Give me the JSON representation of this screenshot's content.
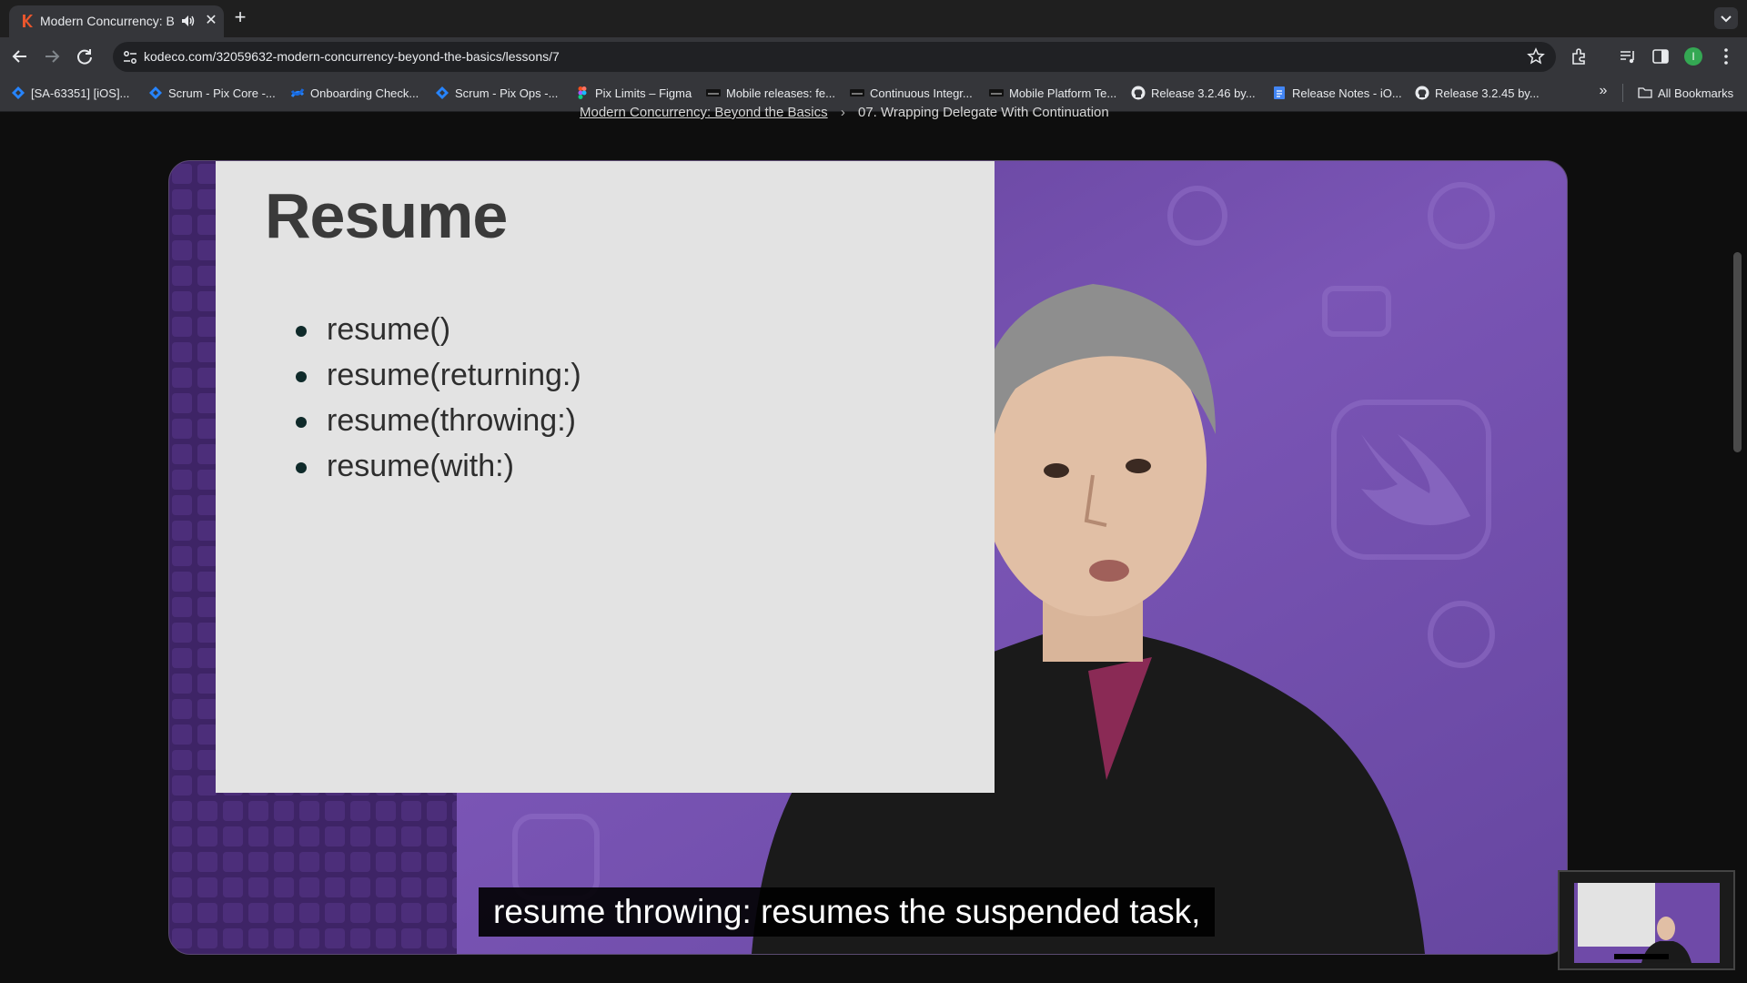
{
  "browser": {
    "tab": {
      "title": "Modern Concurrency: Beyond the Basics",
      "favicon_color": "#e9562d"
    },
    "url": "kodeco.com/32059632-modern-concurrency-beyond-the-basics/lessons/7",
    "profile_initial": "I",
    "bookmarks": [
      {
        "label": "[SA-63351] [iOS]...",
        "icon": "jira-icon"
      },
      {
        "label": "Scrum - Pix Core -...",
        "icon": "jira-icon"
      },
      {
        "label": "Onboarding Check...",
        "icon": "confluence-icon"
      },
      {
        "label": "Scrum - Pix Ops -...",
        "icon": "jira-icon"
      },
      {
        "label": "Pix Limits – Figma",
        "icon": "figma-icon"
      },
      {
        "label": "Mobile releases: fe...",
        "icon": "site-icon"
      },
      {
        "label": "Continuous Integr...",
        "icon": "site-icon"
      },
      {
        "label": "Mobile Platform Te...",
        "icon": "site-icon"
      },
      {
        "label": "Release 3.2.46 by...",
        "icon": "github-icon"
      },
      {
        "label": "Release Notes - iO...",
        "icon": "docs-icon"
      },
      {
        "label": "Release 3.2.45 by...",
        "icon": "github-icon"
      }
    ],
    "all_bookmarks": "All Bookmarks"
  },
  "breadcrumb": {
    "course": "Modern Concurrency: Beyond the Basics",
    "lesson": "07. Wrapping Delegate With Continuation"
  },
  "slide": {
    "title": "Resume",
    "items": [
      "resume()",
      "resume(returning:)",
      "resume(throwing:)",
      "resume(with:)"
    ]
  },
  "caption": "resume throwing: resumes the suspended task,"
}
